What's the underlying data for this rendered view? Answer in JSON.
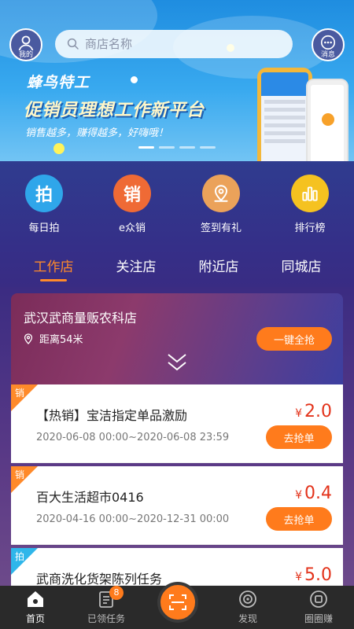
{
  "header": {
    "profile_label": "我的",
    "message_label": "消息",
    "search_placeholder": "商店名称"
  },
  "banner": {
    "brand": "蜂鸟特工",
    "headline": "促销员理想工作新平台",
    "subline": "销售越多，赚得越多，好嗨哦！",
    "slide_count": 4,
    "active_slide": 0
  },
  "quick_actions": [
    {
      "icon": "拍",
      "label": "每日拍",
      "color": "#2fa6ea"
    },
    {
      "icon": "销",
      "label": "e众销",
      "color": "#ef6a35"
    },
    {
      "icon": "location-pin-icon",
      "label": "签到有礼",
      "color": "#eba25a"
    },
    {
      "icon": "bar-chart-icon",
      "label": "排行榜",
      "color": "#f5c220"
    }
  ],
  "tabs": [
    {
      "label": "工作店",
      "active": true
    },
    {
      "label": "关注店",
      "active": false
    },
    {
      "label": "附近店",
      "active": false
    },
    {
      "label": "同城店",
      "active": false
    }
  ],
  "store": {
    "name": "武汉武商量贩农科店",
    "distance": "距离54米",
    "grab_all_label": "一键全抢"
  },
  "tasks": [
    {
      "tag": "销",
      "tag_color": "#ff8a2a",
      "title": "【热销】宝洁指定单品激励",
      "time": "2020-06-08 00:00~2020-06-08 23:59",
      "currency": "¥",
      "price": "2.0",
      "button": "去抢单"
    },
    {
      "tag": "销",
      "tag_color": "#ff8a2a",
      "title": "百大生活超市0416",
      "time": "2020-04-16 00:00~2020-12-31 00:00",
      "currency": "¥",
      "price": "0.4",
      "button": "去抢单"
    },
    {
      "tag": "拍",
      "tag_color": "#2fb6ea",
      "title": "武商洗化货架陈列任务",
      "time": "",
      "currency": "¥",
      "price": "5.0",
      "button": ""
    }
  ],
  "bottom_nav": {
    "home": "首页",
    "tasks": "已领任务",
    "tasks_badge": "8",
    "discover": "发现",
    "circle": "圈圈赚"
  }
}
